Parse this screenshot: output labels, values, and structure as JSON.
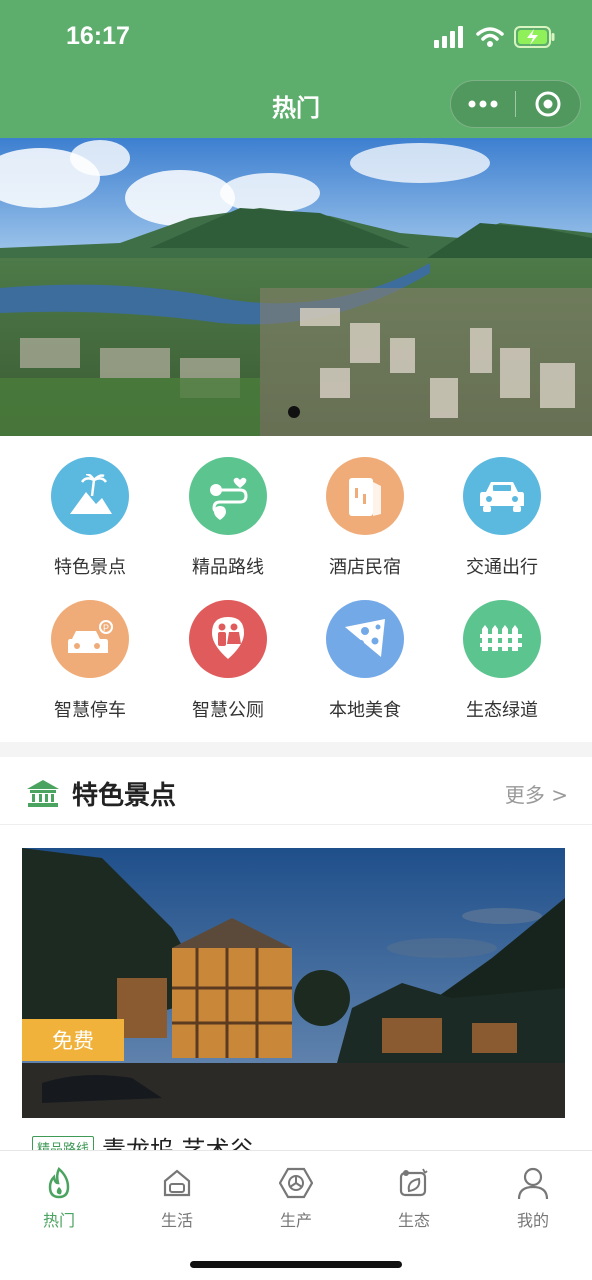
{
  "status": {
    "time": "16:17",
    "icons": [
      "signal-icon",
      "wifi-icon",
      "battery-charging-icon"
    ]
  },
  "nav": {
    "title": "热门",
    "capsule": [
      "more-dots-icon",
      "close-target-icon"
    ]
  },
  "banner": {
    "image": "mountain-valley-town-panorama"
  },
  "grid": [
    {
      "label": "特色景点",
      "icon": "palm-mountain-icon",
      "color": "#5bb8de"
    },
    {
      "label": "精品路线",
      "icon": "route-heart-icon",
      "color": "#5cc48f"
    },
    {
      "label": "酒店民宿",
      "icon": "hotel-door-icon",
      "color": "#f0ac78"
    },
    {
      "label": "交通出行",
      "icon": "car-icon",
      "color": "#5bb8de"
    },
    {
      "label": "智慧停车",
      "icon": "parking-car-icon",
      "color": "#f0ac78"
    },
    {
      "label": "智慧公厕",
      "icon": "toilet-icon",
      "color": "#e05b5b"
    },
    {
      "label": "本地美食",
      "icon": "cheese-icon",
      "color": "#74a9e8"
    },
    {
      "label": "生态绿道",
      "icon": "fence-icon",
      "color": "#5cc48f"
    }
  ],
  "section": {
    "icon": "temple-icon",
    "title": "特色景点",
    "more": "更多 >",
    "card": {
      "tag": "免费",
      "route_tag": "精品路线",
      "title": "青龙坞 艺术谷",
      "image": "night-glass-house-mountain"
    }
  },
  "tabs": [
    {
      "label": "热门",
      "icon": "flame-icon",
      "active": true
    },
    {
      "label": "生活",
      "icon": "sofa-icon",
      "active": false
    },
    {
      "label": "生产",
      "icon": "hexagon-wheel-icon",
      "active": false
    },
    {
      "label": "生态",
      "icon": "eco-leaf-icon",
      "active": false
    },
    {
      "label": "我的",
      "icon": "user-icon",
      "active": false
    }
  ],
  "colors": {
    "primary": "#5dae6c",
    "accent_green": "#4aa35f",
    "tag_orange": "#f0b23a"
  }
}
